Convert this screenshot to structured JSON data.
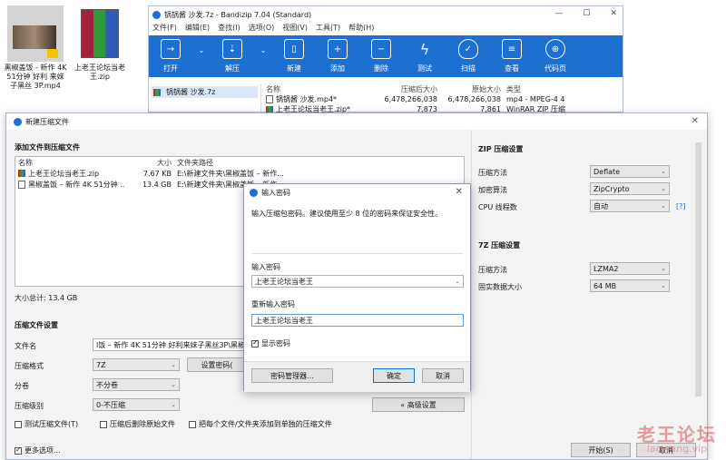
{
  "desktop": {
    "icons": [
      {
        "label": "黑椒盖饭 - 新作 4K 51分钟 好利 来妹子黑丝 3P.mp4"
      },
      {
        "label": "上老王论坛当老 王.zip"
      }
    ]
  },
  "bandizip": {
    "title": "锅锅酱 沙发.7z - Bandizip 7.04 (Standard)",
    "menu": [
      "文件(F)",
      "编辑(E)",
      "查找(I)",
      "选项(O)",
      "视图(V)",
      "工具(T)",
      "帮助(H)"
    ],
    "toolbar": [
      {
        "label": "打开",
        "icon": "open-icon"
      },
      {
        "label": "解压",
        "icon": "extract-icon"
      },
      {
        "label": "新建",
        "icon": "new-archive-icon"
      },
      {
        "label": "添加",
        "icon": "add-icon"
      },
      {
        "label": "删除",
        "icon": "delete-icon"
      },
      {
        "label": "测试",
        "icon": "test-icon"
      },
      {
        "label": "扫描",
        "icon": "scan-icon"
      },
      {
        "label": "查看",
        "icon": "view-icon"
      },
      {
        "label": "代码页",
        "icon": "codepage-icon"
      }
    ],
    "tree_item": "锅锅酱 沙发.7z",
    "columns": {
      "name": "名称",
      "compressed": "压缩后大小",
      "original": "原始大小",
      "type": "类型"
    },
    "rows": [
      {
        "name": "锅锅酱 沙发.mp4*",
        "compressed": "6,478,266,038",
        "original": "6,478,266,038",
        "type": "mp4 - MPEG-4 4"
      },
      {
        "name": "上老王论坛当老王.zip*",
        "compressed": "7,873",
        "original": "7,861",
        "type": "WinRAR ZIP 压缩"
      }
    ]
  },
  "new_archive": {
    "title": "新建压缩文件",
    "add_files_label": "添加文件到压缩文件",
    "list_columns": {
      "name": "名称",
      "size": "大小",
      "path": "文件夹路径"
    },
    "list_rows": [
      {
        "name": "上老王论坛当老王.zip",
        "size": "7.67 KB",
        "path": "E:\\新建文件夹\\黑椒盖饭 – 新作..."
      },
      {
        "name": "黑椒盖饭 – 新作 4K 51分钟 ...",
        "size": "13.4 GB",
        "path": "E:\\新建文件夹\\黑椒盖饭 – 新作..."
      }
    ],
    "total_size": "大小总计: 13.4 GB",
    "settings_label": "压缩文件设置",
    "filename_label": "文件名",
    "filename_value": "l饭 – 新作 4K 51分钟 好利来妹子黑丝3P\\黑椒",
    "format_label": "压缩格式",
    "format_value": "7Z",
    "set_password_button": "设置密码(",
    "split_label": "分卷",
    "split_value": "不分卷",
    "level_label": "压缩级别",
    "level_value": "0-不压缩",
    "advanced_button": "« 高级设置",
    "check_test": "测试压缩文件(T)",
    "check_delete": "压缩后删除原始文件",
    "check_each": "把每个文件/文件夹添加到单独的压缩文件",
    "more_options": "更多选项...",
    "start_button": "开始(S)",
    "cancel_button": "取消"
  },
  "zip_settings": {
    "header": "ZIP 压缩设置",
    "method_label": "压缩方法",
    "method_value": "Deflate",
    "encrypt_label": "加密算法",
    "encrypt_value": "ZipCrypto",
    "threads_label": "CPU 线程数",
    "threads_value": "自动",
    "help": "[?]"
  },
  "sevenz_settings": {
    "header": "7Z 压缩设置",
    "method_label": "压缩方法",
    "method_value": "LZMA2",
    "block_label": "固实数据大小",
    "block_value": "64 MB"
  },
  "password_dialog": {
    "title": "输入密码",
    "message": "输入压缩包密码。建议使用至少 8 位的密码来保证安全性。",
    "enter_label": "输入密码",
    "enter_value": "上老王论坛当老王",
    "reenter_label": "重新输入密码",
    "reenter_value": "上老王论坛当老王",
    "show_password": "显示密码",
    "manager_button": "密码管理器...",
    "ok_button": "确定",
    "cancel_button": "取消"
  },
  "watermark": {
    "big": "老王论坛",
    "small": "laowang.vip"
  }
}
